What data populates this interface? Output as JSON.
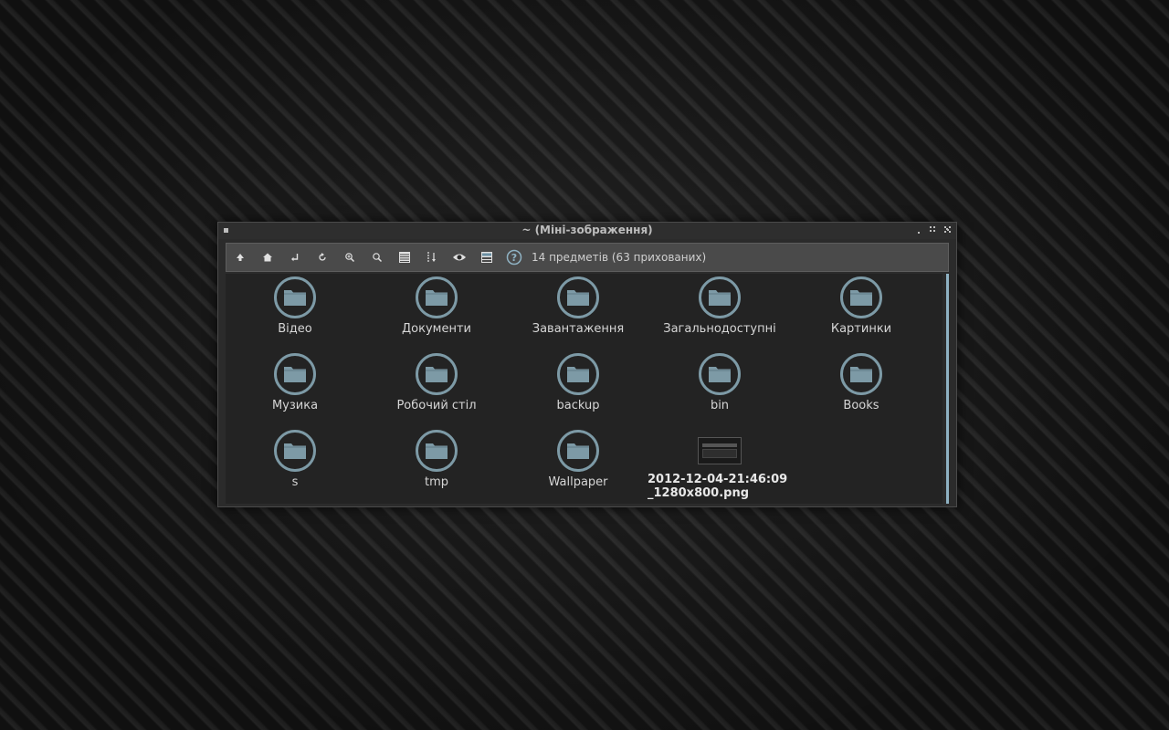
{
  "window": {
    "title": "~ (Міні-зображення)"
  },
  "toolbar": {
    "buttons": [
      {
        "name": "up-icon"
      },
      {
        "name": "home-icon"
      },
      {
        "name": "back-icon"
      },
      {
        "name": "reload-icon"
      },
      {
        "name": "zoom-in-icon"
      },
      {
        "name": "zoom-out-icon"
      },
      {
        "name": "list-view-icon"
      },
      {
        "name": "sort-icon"
      },
      {
        "name": "show-hidden-icon"
      },
      {
        "name": "thumbnail-view-icon"
      },
      {
        "name": "help-icon"
      }
    ],
    "status": "14 предметів (63 прихованих)"
  },
  "items": [
    {
      "label": "Відео",
      "type": "folder"
    },
    {
      "label": "Документи",
      "type": "folder"
    },
    {
      "label": "Завантаження",
      "type": "folder"
    },
    {
      "label": "Загальнодоступні",
      "type": "folder"
    },
    {
      "label": "Картинки",
      "type": "folder"
    },
    {
      "label": "Музика",
      "type": "folder"
    },
    {
      "label": "Робочий стіл",
      "type": "folder"
    },
    {
      "label": "backup",
      "type": "folder"
    },
    {
      "label": "bin",
      "type": "folder"
    },
    {
      "label": "Books",
      "type": "folder"
    },
    {
      "label": "s",
      "type": "folder"
    },
    {
      "label": "tmp",
      "type": "folder"
    },
    {
      "label": "Wallpaper",
      "type": "folder"
    },
    {
      "label": "2012-12-04-21:46:09\n_1280x800.png",
      "type": "image"
    }
  ],
  "colors": {
    "folder_accent": "#7d9aa6",
    "scrollbar": "#8fb2c3"
  }
}
